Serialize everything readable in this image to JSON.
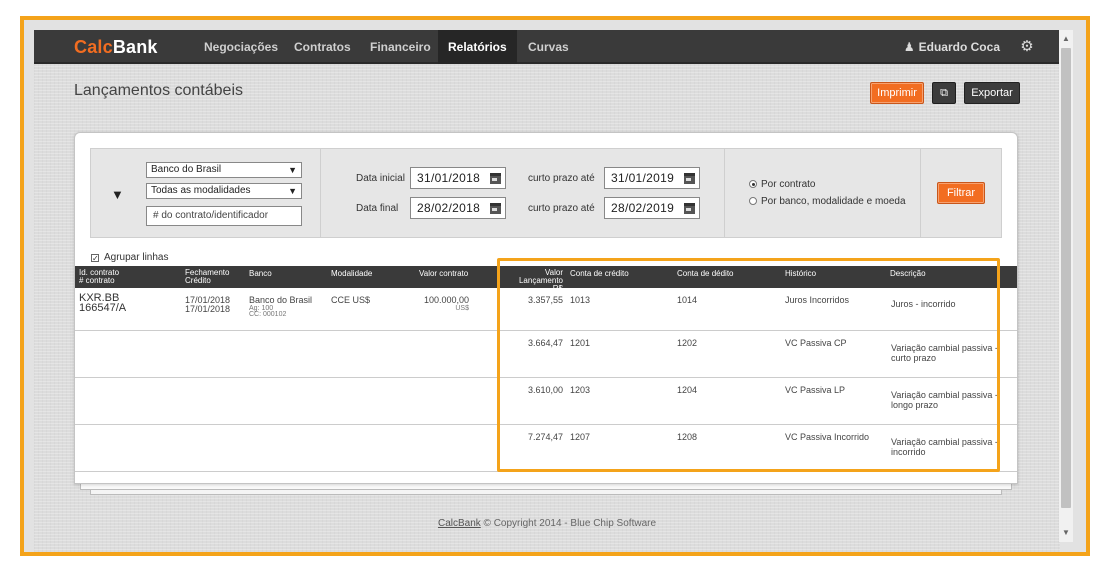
{
  "app": {
    "logo_prefix": "Calc",
    "logo_suffix": "Bank",
    "nav": [
      "Negociações",
      "Contratos",
      "Financeiro",
      "Relatórios",
      "Curvas"
    ],
    "active_nav": "Relatórios",
    "user_name": "Eduardo Coca",
    "accent_color": "#f26d21",
    "highlight_color": "#f4a31a"
  },
  "page": {
    "title": "Lançamentos contábeis",
    "print_label": "Imprimir",
    "export_label": "Exportar"
  },
  "filter": {
    "bank": "Banco do Brasil",
    "modality": "Todas as modalidades",
    "contract_placeholder": "# do contrato/identificador",
    "start_label": "Data inicial",
    "start_date": "31/01/2018",
    "end_label": "Data final",
    "end_date": "28/02/2018",
    "short_term_label": "curto prazo até",
    "short_term_1": "31/01/2019",
    "short_term_2": "28/02/2019",
    "radio_contract": "Por contrato",
    "radio_bank": "Por banco, modalidade e moeda",
    "filter_label": "Filtrar"
  },
  "table": {
    "group_label": "Agrupar linhas",
    "headers": {
      "id_1": "Id. contrato",
      "id_2": "# contrato",
      "closing_1": "Fechamento",
      "closing_2": "Crédito",
      "bank": "Banco",
      "modality": "Modalidade",
      "contract_value": "Valor contrato",
      "entry_value_1": "Valor",
      "entry_value_2": "Lançamento R$",
      "credit_account": "Conta de crédito",
      "debit_account": "Conta de dédito",
      "history": "Histórico",
      "description": "Descrição"
    },
    "contract": {
      "id": "KXR.BB",
      "number": "166547/A",
      "closing": "17/01/2018",
      "credit": "17/01/2018",
      "bank": "Banco do Brasil",
      "agency": "Ag: 100",
      "account": "CC: 000102",
      "modality": "CCE US$",
      "value": "100.000,00",
      "currency": "US$"
    },
    "rows": [
      {
        "value": "3.357,55",
        "credit": "1013",
        "debit": "1014",
        "history": "Juros Incorridos",
        "desc1": "Juros - incorrido",
        "desc2": ""
      },
      {
        "value": "3.664,47",
        "credit": "1201",
        "debit": "1202",
        "history": "VC Passiva CP",
        "desc1": "Variação cambial passiva -",
        "desc2": "curto prazo"
      },
      {
        "value": "3.610,00",
        "credit": "1203",
        "debit": "1204",
        "history": "VC Passiva LP",
        "desc1": "Variação cambial passiva -",
        "desc2": "longo prazo"
      },
      {
        "value": "7.274,47",
        "credit": "1207",
        "debit": "1208",
        "history": "VC Passiva Incorrido",
        "desc1": "Variação cambial passiva -",
        "desc2": "incorrido"
      }
    ]
  },
  "footer": {
    "brand": "CalcBank",
    "text": " © Copyright 2014 - Blue Chip Software"
  }
}
